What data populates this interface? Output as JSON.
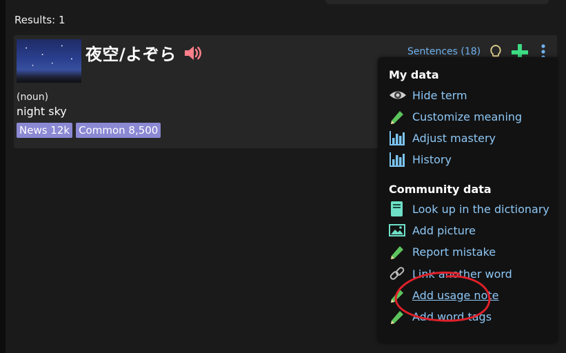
{
  "results_text": "Results: 1",
  "card": {
    "term": "夜空/よぞら",
    "part_of_speech": "(noun)",
    "meaning": "night sky",
    "tags": [
      "News 12k",
      "Common 8,500"
    ],
    "sentences_link": "Sentences (18)"
  },
  "menu": {
    "my_data_title": "My data",
    "my_data_items": [
      {
        "label": "Hide term",
        "icon": "eye-icon"
      },
      {
        "label": "Customize meaning",
        "icon": "pencil-icon"
      },
      {
        "label": "Adjust mastery",
        "icon": "bar-chart-icon"
      },
      {
        "label": "History",
        "icon": "bar-chart-icon"
      }
    ],
    "community_title": "Community data",
    "community_items": [
      {
        "label": "Look up in the dictionary",
        "icon": "book-icon"
      },
      {
        "label": "Add picture",
        "icon": "image-icon"
      },
      {
        "label": "Report mistake",
        "icon": "pencil-icon"
      },
      {
        "label": "Link another word",
        "icon": "link-icon"
      },
      {
        "label": "Add usage note",
        "icon": "pencil-icon"
      },
      {
        "label": "Add word tags",
        "icon": "pencil-icon"
      }
    ]
  },
  "colors": {
    "link": "#8ec7f5",
    "tag_bg": "#8b88d4",
    "plus": "#3ddc84",
    "speaker": "#ff7f8a",
    "annotation": "#e0202a"
  }
}
